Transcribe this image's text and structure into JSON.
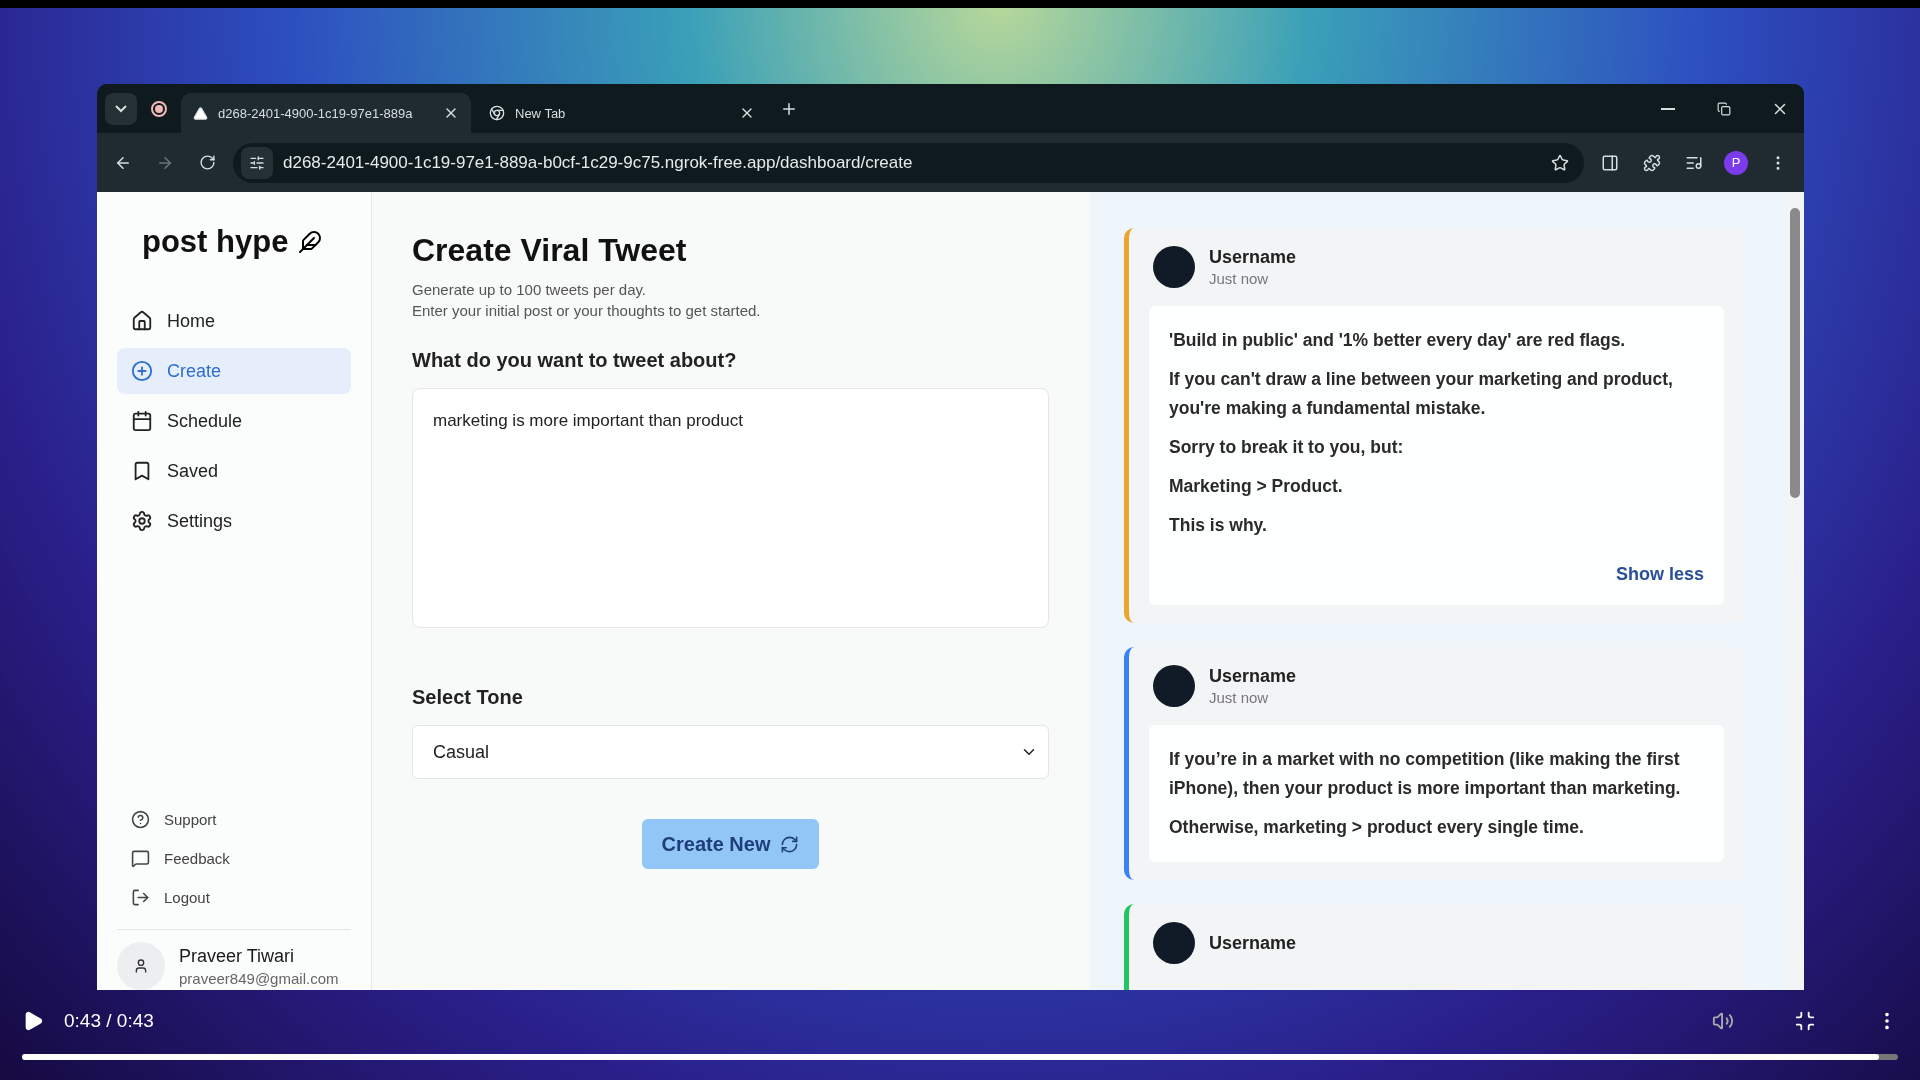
{
  "browser": {
    "tabs": [
      {
        "title": "d268-2401-4900-1c19-97e1-889a",
        "selected": true
      },
      {
        "title": "New Tab",
        "selected": false
      }
    ],
    "url": "d268-2401-4900-1c19-97e1-889a-b0cf-1c29-9c75.ngrok-free.app/dashboard/create",
    "profile_initial": "P"
  },
  "sidebar": {
    "logo": "post hype",
    "nav": [
      {
        "label": "Home",
        "selected": false
      },
      {
        "label": "Create",
        "selected": true
      },
      {
        "label": "Schedule",
        "selected": false
      },
      {
        "label": "Saved",
        "selected": false
      },
      {
        "label": "Settings",
        "selected": false
      }
    ],
    "footer_links": [
      "Support",
      "Feedback",
      "Logout"
    ],
    "user": {
      "name": "Praveer Tiwari",
      "email": "praveer849@gmail.com"
    }
  },
  "main": {
    "title": "Create Viral Tweet",
    "subtitle": [
      "Generate up to 100 tweets per day.",
      "Enter your initial post or your thoughts to get started."
    ],
    "prompt_label": "What do you want to tweet about?",
    "prompt_value": "marketing is more important than product",
    "tone_label": "Select Tone",
    "tone_value": "Casual",
    "button": "Create New"
  },
  "feed": [
    {
      "username": "Username",
      "time": "Just now",
      "color": "#e9a52c",
      "paragraphs": [
        "'Build in public' and '1% better every day' are red flags.",
        "If you can't draw a line between your marketing and product, you're making a fundamental mistake.",
        "Sorry to break it to you, but:",
        "Marketing > Product.",
        "This is why."
      ],
      "toggle": "Show less"
    },
    {
      "username": "Username",
      "time": "Just now",
      "color": "#3b82f6",
      "paragraphs": [
        "If you’re in a market with no competition (like making the first iPhone), then your product is more important than marketing.",
        "Otherwise, marketing > product every single time."
      ]
    },
    {
      "username": "Username",
      "color": "#22c55e"
    }
  ],
  "player": {
    "time": "0:43 / 0:43",
    "level": 0.99
  }
}
